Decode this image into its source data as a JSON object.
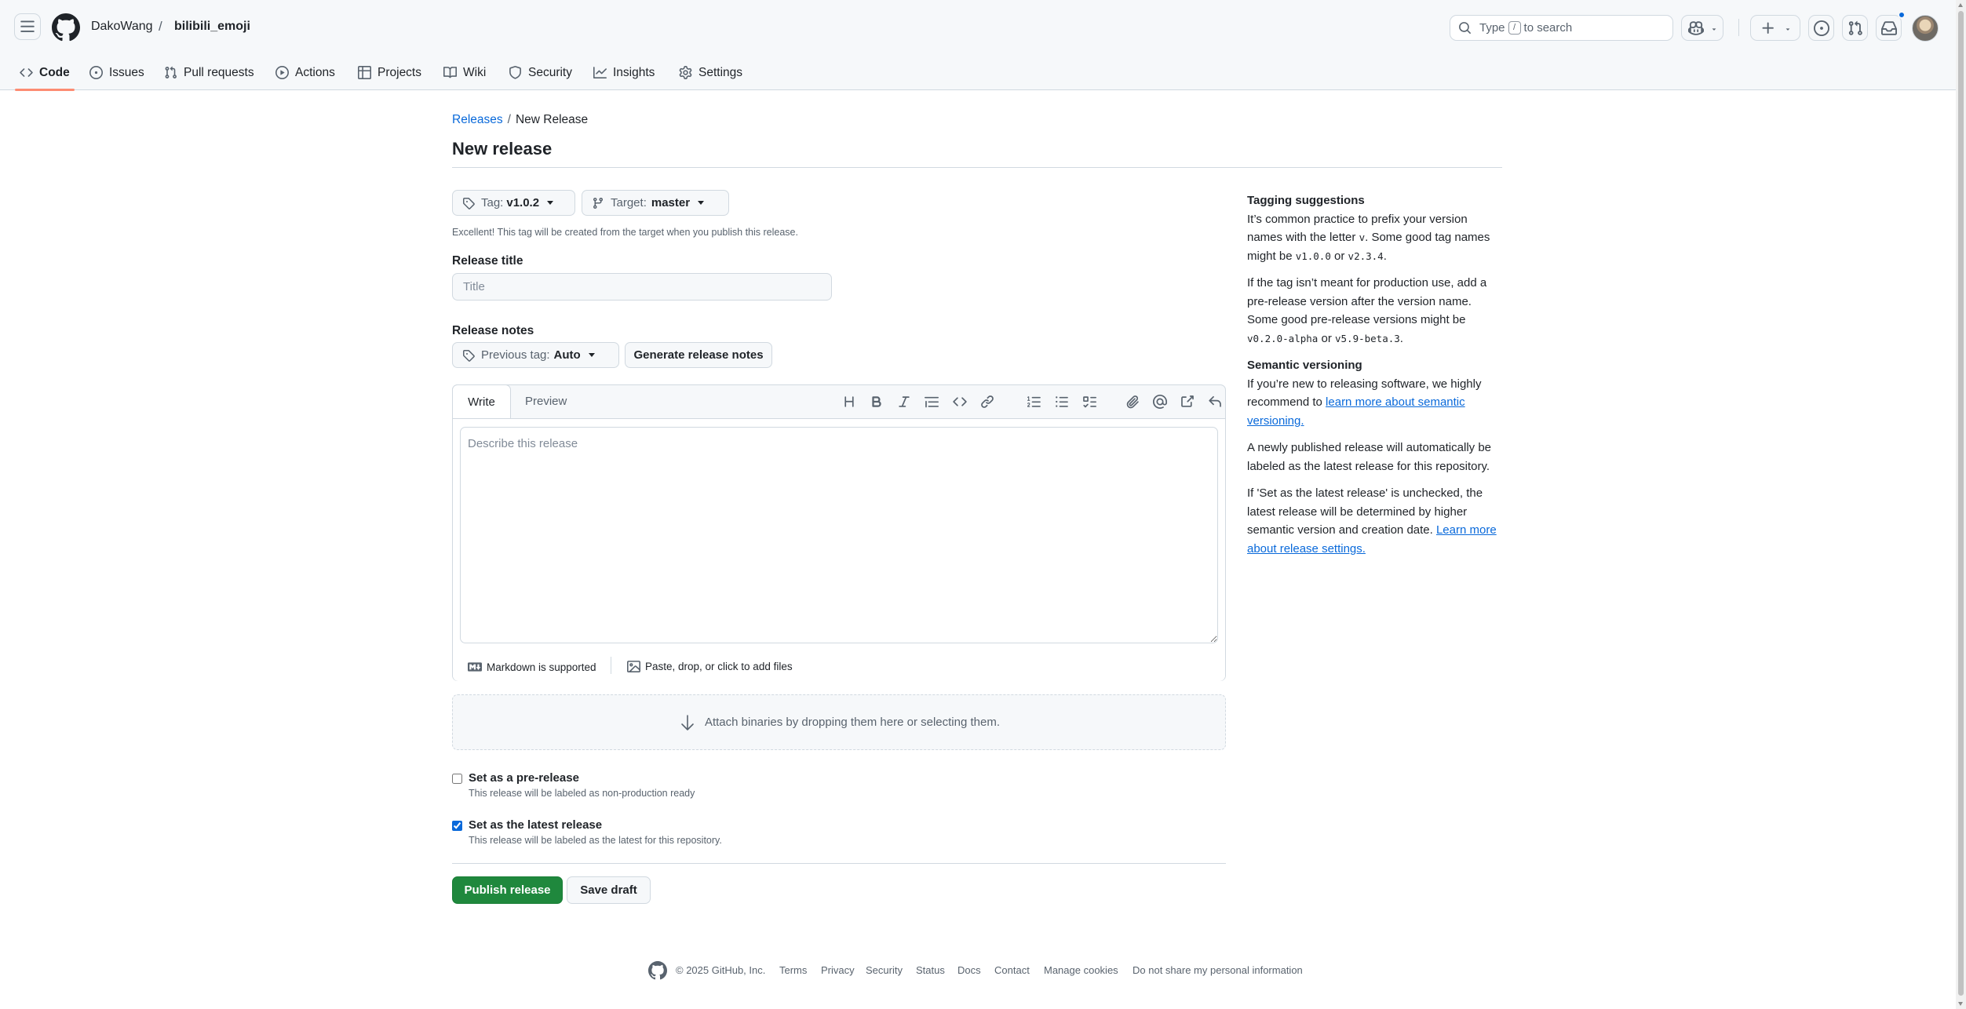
{
  "header": {
    "owner": "DakoWang",
    "separator": "/",
    "repo": "bilibili_emoji",
    "search": {
      "prefix": "Type",
      "key": "/",
      "suffix": "to search"
    },
    "icons": [
      "hamburger-icon",
      "github-logo",
      "search-icon",
      "copilot-icon",
      "plus-icon",
      "issue-icon",
      "pull-request-icon",
      "inbox-icon"
    ]
  },
  "nav": {
    "tabs": [
      {
        "label": "Code",
        "active": true,
        "icon": "code-icon"
      },
      {
        "label": "Issues",
        "icon": "issue-icon"
      },
      {
        "label": "Pull requests",
        "icon": "pull-request-icon"
      },
      {
        "label": "Actions",
        "icon": "play-icon"
      },
      {
        "label": "Projects",
        "icon": "table-icon"
      },
      {
        "label": "Wiki",
        "icon": "book-icon"
      },
      {
        "label": "Security",
        "icon": "shield-icon"
      },
      {
        "label": "Insights",
        "icon": "graph-icon"
      },
      {
        "label": "Settings",
        "icon": "gear-icon"
      }
    ],
    "active_underline_color": "#fd8c73"
  },
  "page": {
    "breadcrumb_link": "Releases",
    "breadcrumb_sep": "/",
    "breadcrumb_current": "New Release",
    "title": "New release",
    "tag_label": "Tag:",
    "tag_value": "v1.0.2",
    "target_label": "Target:",
    "target_value": "master",
    "tag_hint": "Excellent! This tag will be created from the target when you publish this release.",
    "release_title_label": "Release title",
    "release_title_placeholder": "Title",
    "release_notes_label": "Release notes",
    "prev_tag_label": "Previous tag:",
    "prev_tag_value": "Auto",
    "generate_notes": "Generate release notes"
  },
  "editor": {
    "tab_write": "Write",
    "tab_preview": "Preview",
    "placeholder": "Describe this release",
    "markdown_note": "Markdown is supported",
    "paste_note": "Paste, drop, or click to add files",
    "toolbar_icons": [
      "heading-icon",
      "bold-icon",
      "italic-icon",
      "quote-icon",
      "code-icon",
      "link-icon",
      "ordered-list-icon",
      "unordered-list-icon",
      "task-list-icon",
      "attach-icon",
      "mention-icon",
      "cross-reference-icon",
      "undo-icon"
    ]
  },
  "dropzone": {
    "text": "Attach binaries by dropping them here or selecting them."
  },
  "options": {
    "prerelease": {
      "label": "Set as a pre-release",
      "desc": "This release will be labeled as non-production ready",
      "checked": false
    },
    "latest": {
      "label": "Set as the latest release",
      "desc": "This release will be labeled as the latest for this repository.",
      "checked": true
    }
  },
  "actions": {
    "publish": "Publish release",
    "draft": "Save draft",
    "publish_color": "#1f883d"
  },
  "sidebar": {
    "h1": "Tagging suggestions",
    "p1_a": "It’s common practice to prefix your version names with the letter ",
    "p1_code1": "v",
    "p1_b": ". Some good tag names might be ",
    "p1_code2": "v1.0.0",
    "p1_c": " or ",
    "p1_code3": "v2.3.4",
    "p1_d": ".",
    "p2_a": "If the tag isn’t meant for production use, add a pre-release version after the version name. Some good pre-release versions might be ",
    "p2_code1": "v0.2.0-alpha",
    "p2_b": " or ",
    "p2_code2": "v5.9-beta.3",
    "p2_c": ".",
    "h2": "Semantic versioning",
    "p3_a": "If you’re new to releasing software, we highly recommend to ",
    "p3_link": "learn more about semantic versioning.",
    "p4": "A newly published release will automatically be labeled as the latest release for this repository.",
    "p5_a": "If 'Set as the latest release' is unchecked, the latest release will be determined by higher semantic version and creation date. ",
    "p5_link": "Learn more about release settings."
  },
  "footer": {
    "copyright": "© 2025 GitHub, Inc.",
    "links": [
      "Terms",
      "Privacy",
      "Security",
      "Status",
      "Docs",
      "Contact",
      "Manage cookies",
      "Do not share my personal information"
    ]
  }
}
